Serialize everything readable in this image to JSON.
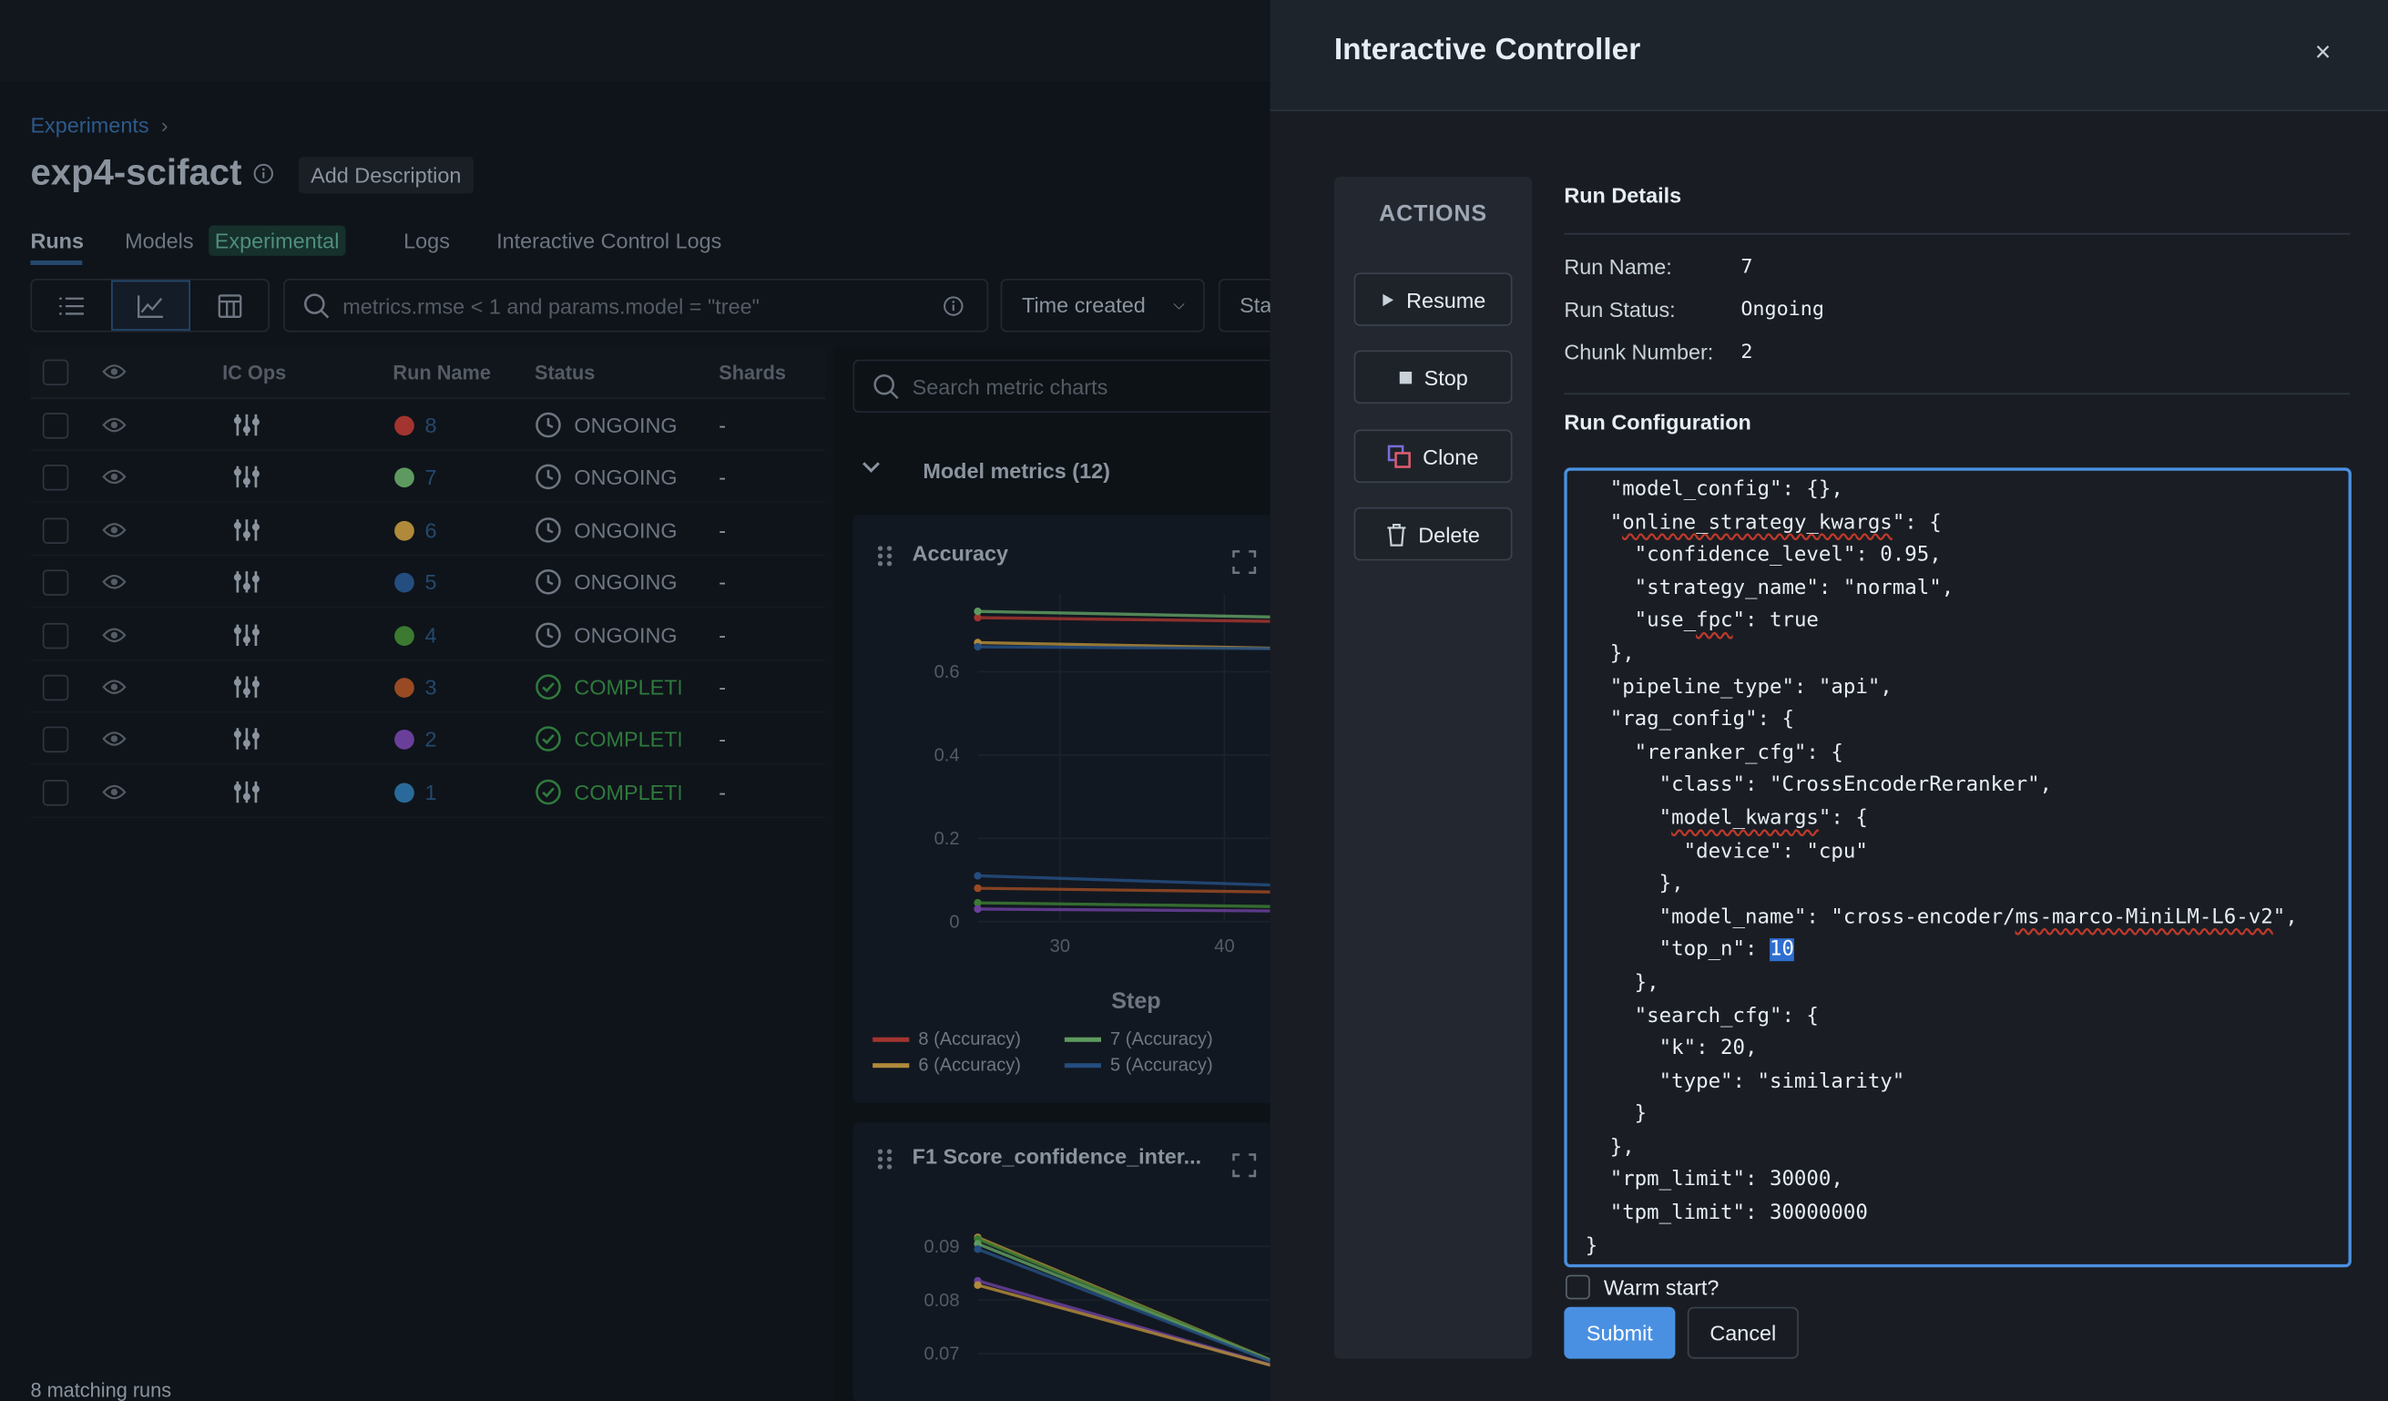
{
  "background": {
    "breadcrumb": "Experiments",
    "breadcrumb_sep": "›",
    "experiment_title": "exp4-scifact",
    "add_description": "Add Description",
    "tabs": {
      "runs": "Runs",
      "models": "Models",
      "experimental": "Experimental",
      "logs": "Logs",
      "ic_logs": "Interactive Control Logs"
    },
    "search_placeholder": "metrics.rmse < 1 and params.model = \"tree\"",
    "sort_dropdown": "Time created",
    "state_dropdown": "Sta",
    "columns": {
      "ic_ops": "IC Ops",
      "run_name": "Run Name",
      "status": "Status",
      "shards": "Shards"
    },
    "runs": [
      {
        "name": "8",
        "color": "#a3342f",
        "status": "ONGOING",
        "shards": "-"
      },
      {
        "name": "7",
        "color": "#5e9a5f",
        "status": "ONGOING",
        "shards": "-"
      },
      {
        "name": "6",
        "color": "#b08a3a",
        "status": "ONGOING",
        "shards": "-"
      },
      {
        "name": "5",
        "color": "#244d80",
        "status": "ONGOING",
        "shards": "-"
      },
      {
        "name": "4",
        "color": "#3c7a32",
        "status": "ONGOING",
        "shards": "-"
      },
      {
        "name": "3",
        "color": "#9a4a22",
        "status": "COMPLETE",
        "shards": "-"
      },
      {
        "name": "2",
        "color": "#6a3f9a",
        "status": "COMPLETE",
        "shards": "-"
      },
      {
        "name": "1",
        "color": "#2a6a9a",
        "status": "COMPLETE",
        "shards": "-"
      }
    ],
    "matching_runs": "8 matching runs",
    "metric_search_placeholder": "Search metric charts",
    "model_metrics": "Model metrics (12)"
  },
  "chart_data": [
    {
      "type": "line",
      "title": "Accuracy",
      "xlabel": "Step",
      "ylabel": "",
      "x_ticks": [
        "30",
        "40"
      ],
      "y_ticks": [
        "0",
        "0.2",
        "0.4",
        "0.6"
      ],
      "ylim": [
        0,
        0.75
      ],
      "x": [
        25,
        45
      ],
      "series": [
        {
          "name": "8 (Accuracy)",
          "color": "#a3342f",
          "values": [
            0.73,
            0.72
          ]
        },
        {
          "name": "7 (Accuracy)",
          "color": "#5e9a5f",
          "values": [
            0.745,
            0.73
          ]
        },
        {
          "name": "6 (Accuracy)",
          "color": "#b08a3a",
          "values": [
            0.67,
            0.655
          ]
        },
        {
          "name": "5 (Accuracy)",
          "color": "#244d80",
          "values": [
            0.66,
            0.655
          ]
        },
        {
          "color": "#244d80",
          "values": [
            0.11,
            0.085
          ]
        },
        {
          "color": "#9a4a22",
          "values": [
            0.08,
            0.07
          ]
        },
        {
          "color": "#3c7a32",
          "values": [
            0.045,
            0.035
          ]
        },
        {
          "color": "#6a3f9a",
          "values": [
            0.03,
            0.025
          ]
        }
      ]
    },
    {
      "type": "line",
      "title": "F1 Score_confidence_inter...",
      "xlabel": "",
      "y_ticks": [
        "0.07",
        "0.08",
        "0.09"
      ],
      "ylim": [
        0.0665,
        0.0935
      ],
      "x": [
        25,
        45
      ],
      "series": [
        {
          "color": "#b08a3a",
          "values": [
            0.0917,
            0.066
          ]
        },
        {
          "color": "#3c7a32",
          "values": [
            0.0914,
            0.066
          ]
        },
        {
          "color": "#5e9a5f",
          "values": [
            0.0905,
            0.066
          ]
        },
        {
          "color": "#244d80",
          "values": [
            0.0895,
            0.066
          ]
        },
        {
          "color": "#6a3f9a",
          "values": [
            0.0836,
            0.066
          ]
        },
        {
          "color": "#b08a3a",
          "values": [
            0.0828,
            0.066
          ]
        }
      ]
    }
  ],
  "modal": {
    "title": "Interactive Controller",
    "close": "×",
    "actions_title": "ACTIONS",
    "actions": {
      "resume": "Resume",
      "stop": "Stop",
      "clone": "Clone",
      "delete": "Delete"
    },
    "run_details_title": "Run Details",
    "details": {
      "run_name_label": "Run Name:",
      "run_name": "7",
      "run_status_label": "Run Status:",
      "run_status": "Ongoing",
      "chunk_label": "Chunk Number:",
      "chunk": "2"
    },
    "run_config_title": "Run Configuration",
    "config_lines": [
      {
        "pre": "  \"model_config\": {},"
      },
      {
        "pre": "  \"",
        "mark": "online_strategy_kwargs",
        "post": "\": {"
      },
      {
        "pre": "    \"confidence_level\": 0.95,"
      },
      {
        "pre": "    \"strategy_name\": \"normal\","
      },
      {
        "pre": "    \"use_",
        "mark": "fpc",
        "post": "\": true"
      },
      {
        "pre": "  },"
      },
      {
        "pre": "  \"pipeline_type\": \"api\","
      },
      {
        "pre": "  \"rag_config\": {"
      },
      {
        "pre": "    \"reranker_cfg\": {"
      },
      {
        "pre": "      \"class\": \"CrossEncoderReranker\","
      },
      {
        "pre": "      \"",
        "mark": "model_kwargs",
        "post": "\": {"
      },
      {
        "pre": "        \"device\": \"cpu\""
      },
      {
        "pre": "      },"
      },
      {
        "pre": "      \"model_name\": \"cross-encoder/",
        "mark": "ms-marco-MiniLM-L6-v2",
        "post": "\","
      },
      {
        "pre": "      \"top_n\": ",
        "hl": "10"
      },
      {
        "pre": "    },"
      },
      {
        "pre": "    \"search_cfg\": {"
      },
      {
        "pre": "      \"k\": 20,"
      },
      {
        "pre": "      \"type\": \"similarity\""
      },
      {
        "pre": "    }"
      },
      {
        "pre": "  },"
      },
      {
        "pre": "  \"rpm_limit\": 30000,"
      },
      {
        "pre": "  \"tpm_limit\": 30000000"
      },
      {
        "pre": "}"
      }
    ],
    "warm_start_label": "Warm start?",
    "submit": "Submit",
    "cancel": "Cancel",
    "accent": "#4a90e2"
  }
}
